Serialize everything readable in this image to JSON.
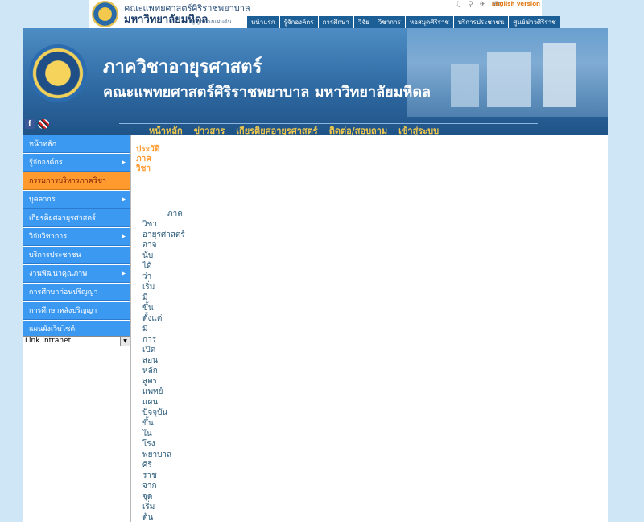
{
  "topbar": {
    "name_line1": "คณะแพทยศาสตร์ศิริราชพยาบาล",
    "name_line2": "มหาวิทยาลัยมหิดล",
    "motto": "ปัญญาของแผ่นดิน",
    "english_link": "English version",
    "menu": [
      "หน้าแรก",
      "รู้จักองค์กร",
      "การศึกษา",
      "วิจัย",
      "วิชาการ",
      "หอสมุดศิริราช",
      "บริการประชาชน",
      "ศูนย์ข่าวศิริราช"
    ]
  },
  "banner": {
    "title_line1": "ภาควิชาอายุรศาสตร์",
    "title_line2": "คณะแพทยศาสตร์ศิริราชพยาบาล มหาวิทยาลัยมหิดล",
    "nav": [
      "หน้าหลัก",
      "ข่าวสาร",
      "เกียรติยศอายุรศาสตร์",
      "ติดต่อ/สอบถาม",
      "เข้าสู่ระบบ"
    ]
  },
  "sidebar": {
    "items": [
      {
        "label": "หน้าหลัก",
        "arrow": false,
        "active": false
      },
      {
        "label": "รู้จักองค์กร",
        "arrow": true,
        "active": false
      },
      {
        "label": "กรรมการบริหารภาควิชา",
        "arrow": false,
        "active": true
      },
      {
        "label": "บุคลากร",
        "arrow": true,
        "active": false
      },
      {
        "label": "เกียรติยศอายุรศาสตร์",
        "arrow": false,
        "active": false
      },
      {
        "label": "วิจัยวิชาการ",
        "arrow": true,
        "active": false
      },
      {
        "label": "บริการประชาชน",
        "arrow": false,
        "active": false
      },
      {
        "label": "งานพัฒนาคุณภาพ",
        "arrow": true,
        "active": false
      },
      {
        "label": "การศึกษาก่อนปริญญา",
        "arrow": false,
        "active": false
      },
      {
        "label": "การศึกษาหลังปริญญา",
        "arrow": false,
        "active": false
      },
      {
        "label": "แผนผังเว็บไซต์",
        "arrow": false,
        "active": false
      }
    ],
    "select_value": "Link Intranet"
  },
  "content": {
    "orange_words": [
      "ประวัติ",
      "ภาค",
      "วิชา"
    ],
    "title": "ภาค",
    "words": [
      "วิชา",
      "อายุรศาสตร์",
      "อาจ",
      "นับ",
      "ได้",
      "ว่า",
      "เริ่ม",
      "มี",
      "ขึ้น",
      "ตั้งแต่",
      "มี",
      "การ",
      "เปิด",
      "สอน",
      "หลัก",
      "สูตร",
      "แพทย์",
      "แผน",
      "ปัจจุบัน",
      "ขึ้น",
      "ใน",
      "โรง",
      "พยาบาล",
      "ศิริ",
      "ราช",
      "จาก",
      "จุด",
      "เริ่ม",
      "ต้น"
    ]
  },
  "colors": {
    "menu_blue": "#3c99f2",
    "menu_active": "#ff9a2e",
    "banner_blue": "#2f6aa3",
    "nav_gold": "#f2c94c"
  }
}
